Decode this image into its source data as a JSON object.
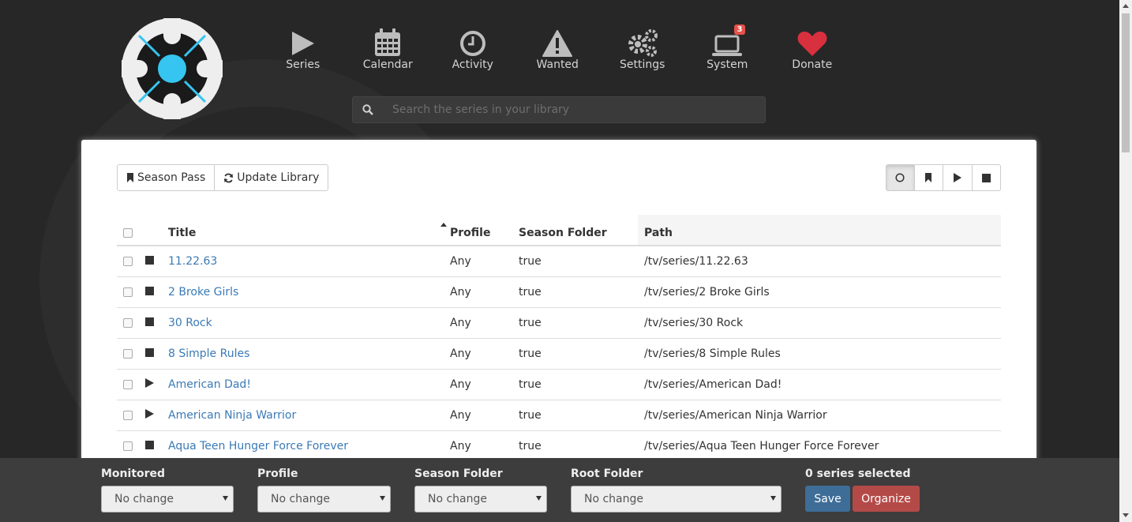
{
  "nav": [
    {
      "label": "Series",
      "icon": "play-icon"
    },
    {
      "label": "Calendar",
      "icon": "calendar-icon"
    },
    {
      "label": "Activity",
      "icon": "clock-icon"
    },
    {
      "label": "Wanted",
      "icon": "warning-icon"
    },
    {
      "label": "Settings",
      "icon": "gears-icon"
    },
    {
      "label": "System",
      "icon": "laptop-icon",
      "badge": "3"
    },
    {
      "label": "Donate",
      "icon": "heart-icon"
    }
  ],
  "search": {
    "placeholder": "Search the series in your library"
  },
  "toolbar": {
    "season_pass": "Season Pass",
    "update_library": "Update Library"
  },
  "table": {
    "headers": {
      "title": "Title",
      "profile": "Profile",
      "season_folder": "Season Folder",
      "path": "Path"
    },
    "rows": [
      {
        "status": "ended",
        "title": "11.22.63",
        "profile": "Any",
        "season_folder": "true",
        "path": "/tv/series/11.22.63"
      },
      {
        "status": "ended",
        "title": "2 Broke Girls",
        "profile": "Any",
        "season_folder": "true",
        "path": "/tv/series/2 Broke Girls"
      },
      {
        "status": "ended",
        "title": "30 Rock",
        "profile": "Any",
        "season_folder": "true",
        "path": "/tv/series/30 Rock"
      },
      {
        "status": "ended",
        "title": "8 Simple Rules",
        "profile": "Any",
        "season_folder": "true",
        "path": "/tv/series/8 Simple Rules"
      },
      {
        "status": "continuing",
        "title": "American Dad!",
        "profile": "Any",
        "season_folder": "true",
        "path": "/tv/series/American Dad!"
      },
      {
        "status": "continuing",
        "title": "American Ninja Warrior",
        "profile": "Any",
        "season_folder": "true",
        "path": "/tv/series/American Ninja Warrior"
      },
      {
        "status": "ended",
        "title": "Aqua Teen Hunger Force Forever",
        "profile": "Any",
        "season_folder": "true",
        "path": "/tv/series/Aqua Teen Hunger Force Forever"
      }
    ]
  },
  "footer": {
    "monitored": {
      "label": "Monitored",
      "value": "No change"
    },
    "profile": {
      "label": "Profile",
      "value": "No change"
    },
    "season_folder": {
      "label": "Season Folder",
      "value": "No change"
    },
    "root_folder": {
      "label": "Root Folder",
      "value": "No change"
    },
    "selected_count": "0 series selected",
    "save": "Save",
    "organize": "Organize"
  },
  "colors": {
    "accent": "#3a7ab5",
    "save": "#3e6d97",
    "organize": "#b44a47",
    "heart": "#d9303f",
    "badge": "#e5534b",
    "logo_blue": "#35c5f0"
  }
}
